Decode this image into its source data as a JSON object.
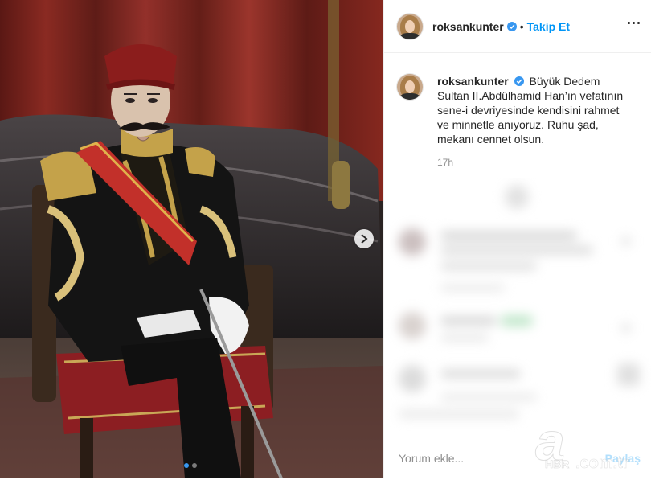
{
  "post": {
    "username": "roksankunter",
    "separator": "•",
    "follow_label": "Takip Et",
    "caption": "Büyük Dedem Sultan II.Abdülhamid Han’ın vefatının sene-i devriyesinde kendisini rahmet ve minnetle anıyoruz. Ruhu şad, mekanı cennet olsun.",
    "time": "17h"
  },
  "add_comment": {
    "placeholder": "Yorum ekle...",
    "post_label": "Paylaş"
  },
  "carousel": {
    "slide_count": 2,
    "active_index": 0
  },
  "watermark": {
    "text_a": "a",
    "text_hbr": "HBR",
    "text_domain": ".com.tr"
  },
  "colors": {
    "accent": "#0095f6",
    "verified": "#3897f0"
  },
  "icons": [
    "chevron-right-icon",
    "verified-badge-icon",
    "more-options-icon"
  ]
}
